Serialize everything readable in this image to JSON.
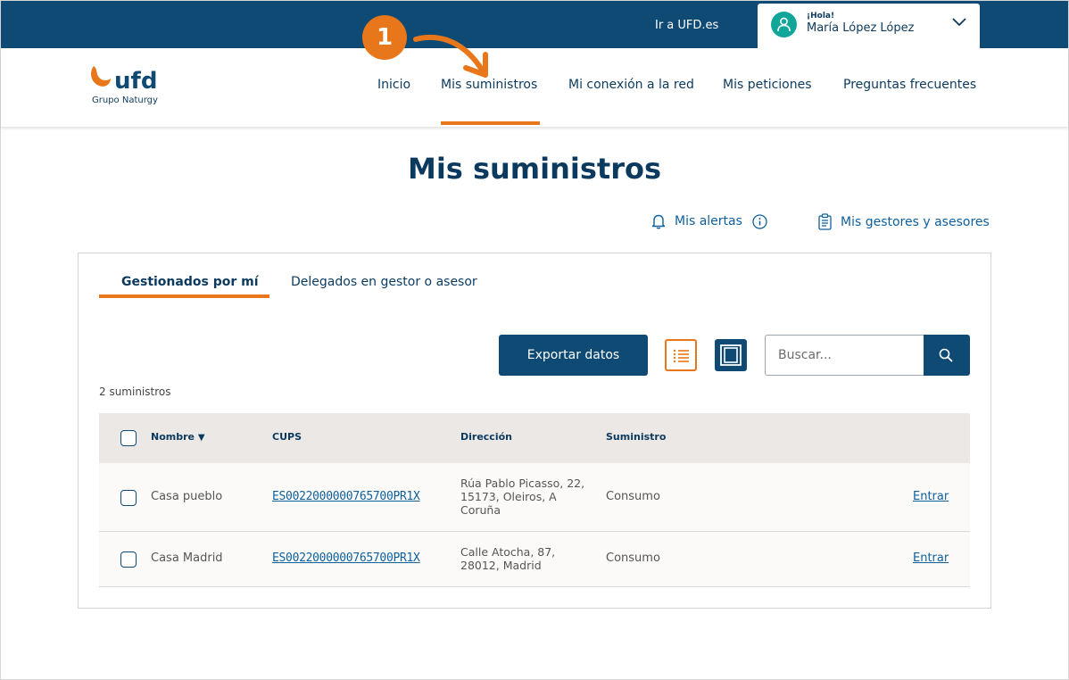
{
  "topbar": {
    "link": "Ir a UFD.es",
    "greeting": "¡Hola!",
    "user_name": "María López López"
  },
  "brand": {
    "logo_text": "ufd",
    "subtitle": "Grupo Naturgy",
    "accent": "#e8761a",
    "primary": "#0e4a74"
  },
  "nav": {
    "items": [
      "Inicio",
      "Mis suministros",
      "Mi conexión a la red",
      "Mis peticiones",
      "Preguntas frecuentes"
    ],
    "active_index": 1
  },
  "annotation": {
    "step": "1"
  },
  "page": {
    "title": "Mis suministros",
    "alerts_label": "Mis alertas",
    "managers_label": "Mis gestores y asesores"
  },
  "tabs": [
    "Gestionados por mí",
    "Delegados en gestor o asesor"
  ],
  "toolbar": {
    "export_label": "Exportar datos",
    "search_placeholder": "Buscar..."
  },
  "count_label": "2 suministros",
  "table": {
    "headers": [
      "Nombre",
      "CUPS",
      "Dirección",
      "Suministro"
    ],
    "rows": [
      {
        "name": "Casa pueblo",
        "cups": "ES0022000000765700PR1X",
        "address": "Rúa Pablo Picasso, 22, 15173, Oleiros, A Coruña",
        "supply": "Consumo",
        "action": "Entrar"
      },
      {
        "name": "Casa Madrid",
        "cups": "ES0022000000765700PR1X",
        "address": "Calle Atocha, 87, 28012, Madrid",
        "supply": "Consumo",
        "action": "Entrar"
      }
    ]
  }
}
